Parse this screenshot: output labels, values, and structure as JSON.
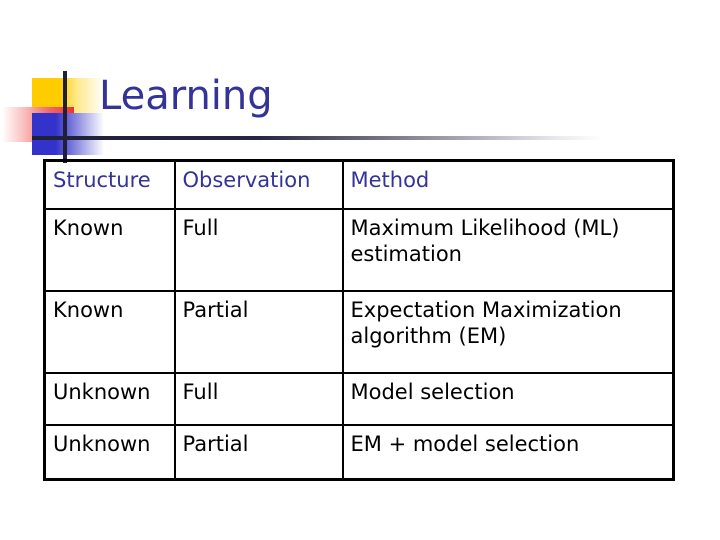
{
  "slide": {
    "title": "Learning",
    "title_color": "#333399",
    "ornament": {
      "yellow_color": "#FFCC00",
      "red_color": "#F03030",
      "blue_color": "#3333CC",
      "line_color": "#1F1F38"
    }
  },
  "table": {
    "columns": [
      "Structure",
      "Observation",
      "Method"
    ],
    "rows": [
      [
        "Known",
        "Full",
        "Maximum Likelihood (ML) estimation"
      ],
      [
        "Known",
        "Partial",
        "Expectation Maximization algorithm (EM)"
      ],
      [
        "Unknown",
        "Full",
        "Model selection"
      ],
      [
        "Unknown",
        "Partial",
        "EM + model selection"
      ]
    ]
  }
}
